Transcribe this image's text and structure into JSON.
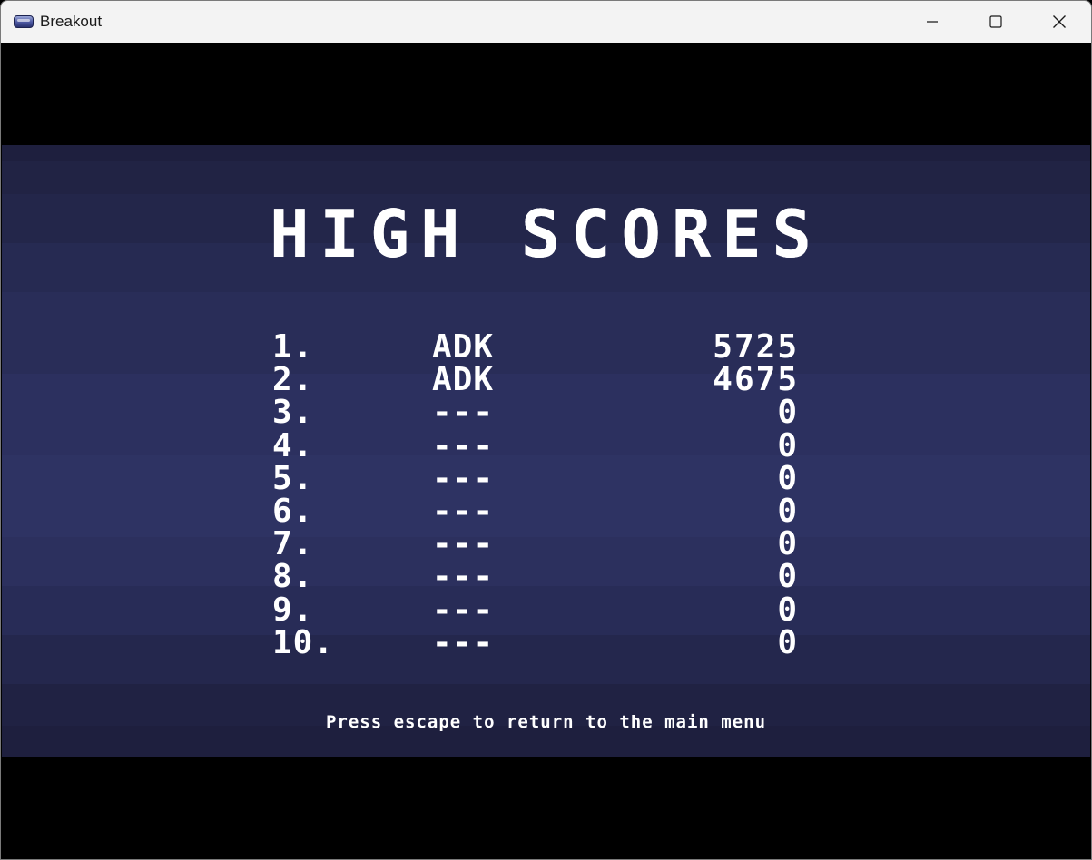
{
  "window": {
    "title": "Breakout",
    "app_icon": "breakout-icon",
    "controls": [
      "minimize-icon",
      "maximize-icon",
      "close-icon"
    ]
  },
  "screen": {
    "heading": "HIGH SCORES",
    "scores": [
      {
        "rank": "1.",
        "name": "ADK",
        "score": "5725"
      },
      {
        "rank": "2.",
        "name": "ADK",
        "score": "4675"
      },
      {
        "rank": "3.",
        "name": "---",
        "score": "0"
      },
      {
        "rank": "4.",
        "name": "---",
        "score": "0"
      },
      {
        "rank": "5.",
        "name": "---",
        "score": "0"
      },
      {
        "rank": "6.",
        "name": "---",
        "score": "0"
      },
      {
        "rank": "7.",
        "name": "---",
        "score": "0"
      },
      {
        "rank": "8.",
        "name": "---",
        "score": "0"
      },
      {
        "rank": "9.",
        "name": "---",
        "score": "0"
      },
      {
        "rank": "10.",
        "name": "---",
        "score": "0"
      }
    ],
    "hint": "Press escape to return to the main menu"
  },
  "colors": {
    "background": "#000000",
    "panel": "#2c305f",
    "text": "#ffffff",
    "titlebar": "#f3f3f3"
  }
}
